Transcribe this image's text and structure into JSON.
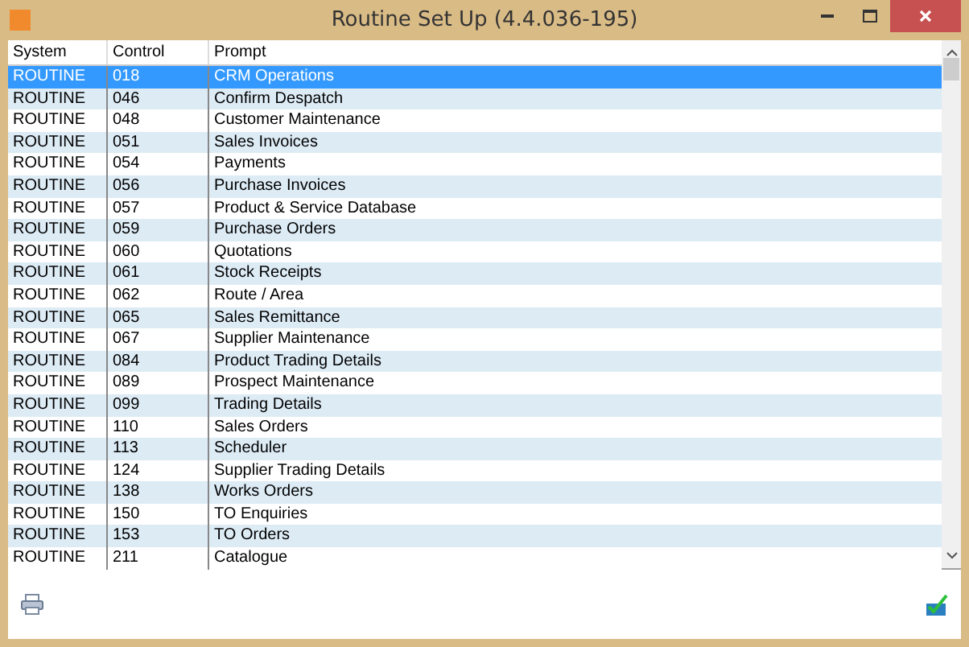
{
  "window": {
    "title": "Routine Set Up (4.4.036-195)"
  },
  "table": {
    "columns": [
      "System",
      "Control",
      "Prompt"
    ],
    "rows": [
      {
        "cells": [
          "ROUTINE",
          "018",
          "CRM Operations"
        ],
        "selected": true
      },
      {
        "cells": [
          "ROUTINE",
          "046",
          "Confirm Despatch"
        ],
        "selected": false
      },
      {
        "cells": [
          "ROUTINE",
          "048",
          "Customer Maintenance"
        ],
        "selected": false
      },
      {
        "cells": [
          "ROUTINE",
          "051",
          "Sales Invoices"
        ],
        "selected": false
      },
      {
        "cells": [
          "ROUTINE",
          "054",
          "Payments"
        ],
        "selected": false
      },
      {
        "cells": [
          "ROUTINE",
          "056",
          "Purchase Invoices"
        ],
        "selected": false
      },
      {
        "cells": [
          "ROUTINE",
          "057",
          "Product & Service Database"
        ],
        "selected": false
      },
      {
        "cells": [
          "ROUTINE",
          "059",
          "Purchase Orders"
        ],
        "selected": false
      },
      {
        "cells": [
          "ROUTINE",
          "060",
          "Quotations"
        ],
        "selected": false
      },
      {
        "cells": [
          "ROUTINE",
          "061",
          "Stock Receipts"
        ],
        "selected": false
      },
      {
        "cells": [
          "ROUTINE",
          "062",
          "Route / Area"
        ],
        "selected": false
      },
      {
        "cells": [
          "ROUTINE",
          "065",
          "Sales Remittance"
        ],
        "selected": false
      },
      {
        "cells": [
          "ROUTINE",
          "067",
          "Supplier Maintenance"
        ],
        "selected": false
      },
      {
        "cells": [
          "ROUTINE",
          "084",
          "Product Trading Details"
        ],
        "selected": false
      },
      {
        "cells": [
          "ROUTINE",
          "089",
          "Prospect Maintenance"
        ],
        "selected": false
      },
      {
        "cells": [
          "ROUTINE",
          "099",
          "Trading Details"
        ],
        "selected": false
      },
      {
        "cells": [
          "ROUTINE",
          "110",
          "Sales Orders"
        ],
        "selected": false
      },
      {
        "cells": [
          "ROUTINE",
          "113",
          "Scheduler"
        ],
        "selected": false
      },
      {
        "cells": [
          "ROUTINE",
          "124",
          "Supplier Trading Details"
        ],
        "selected": false
      },
      {
        "cells": [
          "ROUTINE",
          "138",
          "Works Orders"
        ],
        "selected": false
      },
      {
        "cells": [
          "ROUTINE",
          "150",
          "TO Enquiries"
        ],
        "selected": false
      },
      {
        "cells": [
          "ROUTINE",
          "153",
          "TO Orders"
        ],
        "selected": false
      },
      {
        "cells": [
          "ROUTINE",
          "211",
          "Catalogue"
        ],
        "selected": false
      }
    ]
  }
}
